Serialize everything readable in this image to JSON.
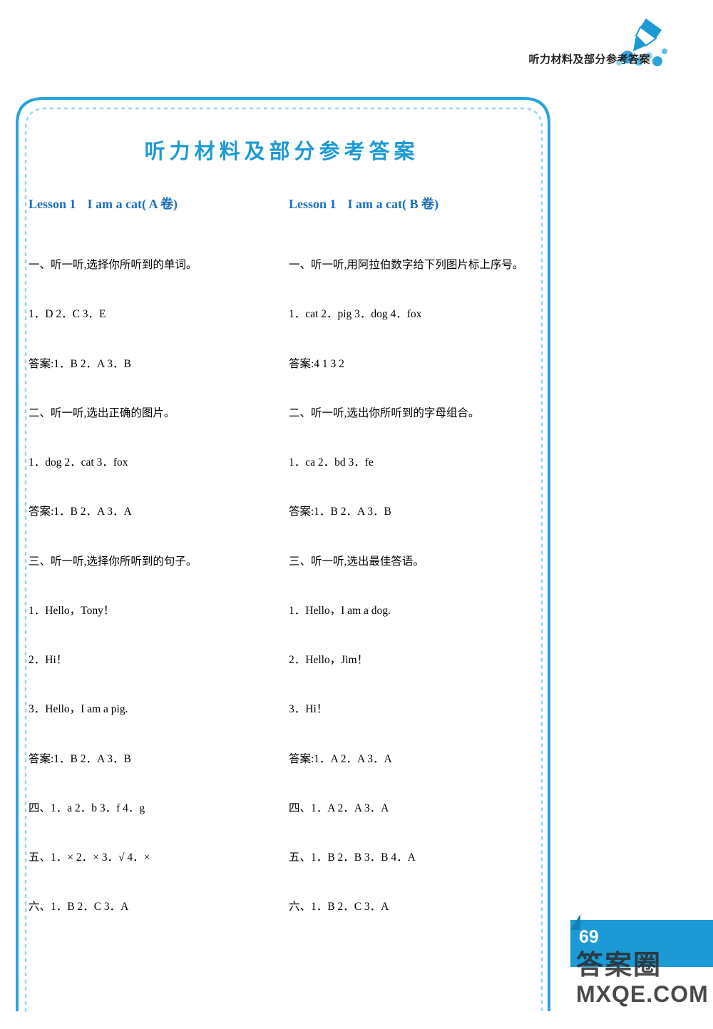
{
  "header": {
    "running_title": "听力材料及部分参考答案",
    "ink_icon": "pen-splash-icon"
  },
  "banner": {
    "title": "听力材料及部分参考答案"
  },
  "columns": [
    {
      "id": "left",
      "lesson_no": "Lesson 1",
      "lesson_title": "I am a cat",
      "lesson_volume": "( A 卷)",
      "lines": [
        "一、听一听,选择你所听到的单词。",
        "1．D  2．C  3．E",
        "答案:1．B  2．A  3．B",
        "二、听一听,选出正确的图片。",
        "1．dog  2．cat  3．fox",
        "答案:1．B  2．A  3．A",
        "三、听一听,选择你所听到的句子。",
        "1．Hello，Tony！",
        "2．Hi！",
        "3．Hello，I am a pig.",
        "答案:1．B  2．A  3．B",
        "四、1．a  2．b  3．f  4．g",
        "五、1．×  2．×  3．√  4．×",
        "六、1．B  2．C  3．A"
      ]
    },
    {
      "id": "right",
      "lesson_no": "Lesson 1",
      "lesson_title": "I am a cat",
      "lesson_volume": "( B 卷)",
      "lines": [
        "一、听一听,用阿拉伯数字给下列图片标上序号。",
        "1．cat  2．pig  3．dog  4．fox",
        "答案:4 1 3 2",
        "二、听一听,选出你所听到的字母组合。",
        "1．ca  2．bd  3．fe",
        "答案:1．B  2．A  3．B",
        "三、听一听,选出最佳答语。",
        "1．Hello，I am a dog.",
        "2．Hello，Jim！",
        "3．Hi！",
        "答案:1．A  2．A  3．A",
        "四、1．A  2．A  3．A",
        "五、1．B  2．B  3．B  4．A",
        "六、1．B  2．C  3．A"
      ]
    }
  ],
  "page_number": "69",
  "watermark": {
    "chinese": "答案圈",
    "english": "MXQE.COM"
  },
  "colors": {
    "accent_blue": "#1b9ad6",
    "heading_blue": "#1b6fba",
    "frame_blue": "#29a3dc",
    "text_black": "#000000"
  }
}
